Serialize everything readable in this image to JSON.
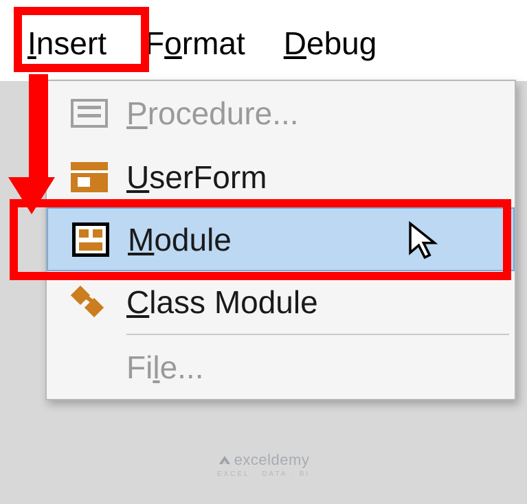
{
  "menubar": {
    "items": [
      {
        "prefix": "I",
        "rest": "nsert"
      },
      {
        "prefix": "F",
        "rest": "ormat",
        "preU": "",
        "u": "o"
      },
      {
        "prefix": "D",
        "rest": "ebug"
      }
    ],
    "insert_label_u": "I",
    "insert_label_rest": "nsert",
    "format_pre": "F",
    "format_u": "o",
    "format_rest": "rmat",
    "debug_u": "D",
    "debug_rest": "ebug"
  },
  "dropdown": {
    "procedure_u": "P",
    "procedure_rest": "rocedure...",
    "userform_u": "U",
    "userform_rest": "serForm",
    "module_u": "M",
    "module_rest": "odule",
    "class_pre": "",
    "class_u": "C",
    "class_rest": "lass Module",
    "file_pre": "Fi",
    "file_u": "l",
    "file_rest": "e..."
  },
  "watermark": {
    "text": "exceldemy",
    "sub": "EXCEL · DATA · BI"
  }
}
